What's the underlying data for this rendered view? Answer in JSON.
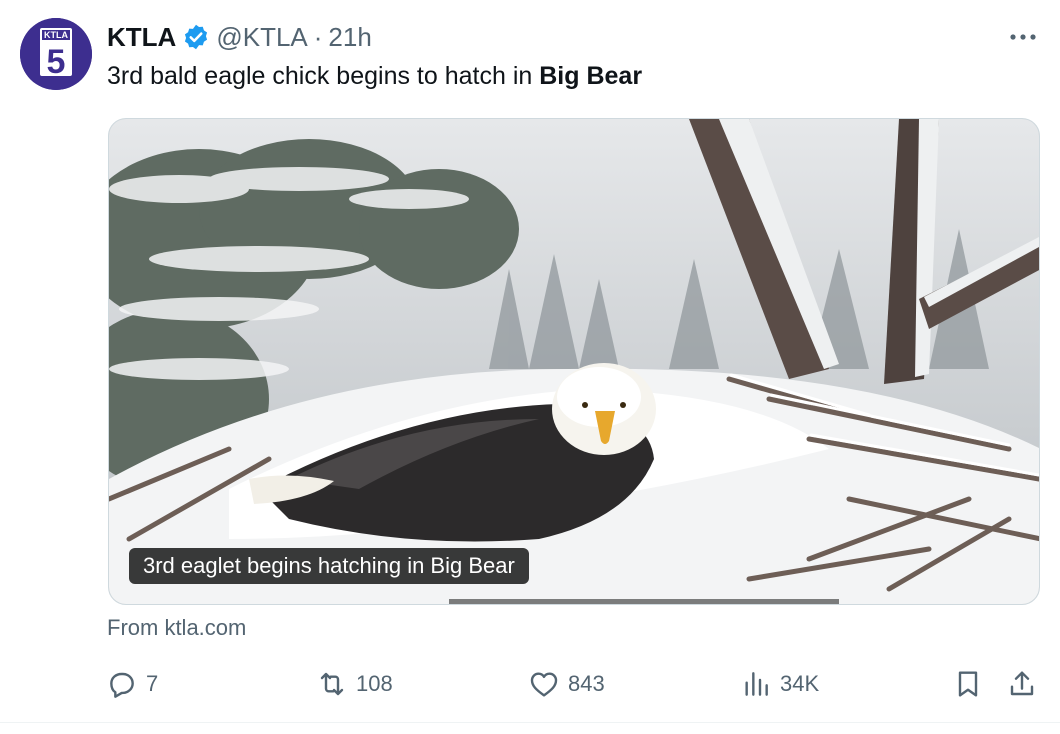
{
  "tweet": {
    "author_name": "KTLA",
    "handle": "@KTLA",
    "separator": "·",
    "time": "21h",
    "more_label": "···",
    "text_main": "3rd bald eagle chick begins to hatch in ",
    "text_bold": "Big Bear",
    "avatar_logo": "KTLA",
    "avatar_number": "5"
  },
  "media": {
    "caption": "3rd eaglet begins hatching in Big Bear",
    "source": "From ktla.com"
  },
  "actions": {
    "replies": "7",
    "reposts": "108",
    "likes": "843",
    "views": "34K"
  },
  "icons": [
    "verified-badge-icon",
    "more-icon",
    "reply-icon",
    "repost-icon",
    "like-icon",
    "views-icon",
    "bookmark-icon",
    "share-icon"
  ],
  "colors": {
    "verified": "#1d9bf0",
    "text": "#0f1419",
    "muted": "#536471",
    "avatar": "#3d2e8f"
  }
}
